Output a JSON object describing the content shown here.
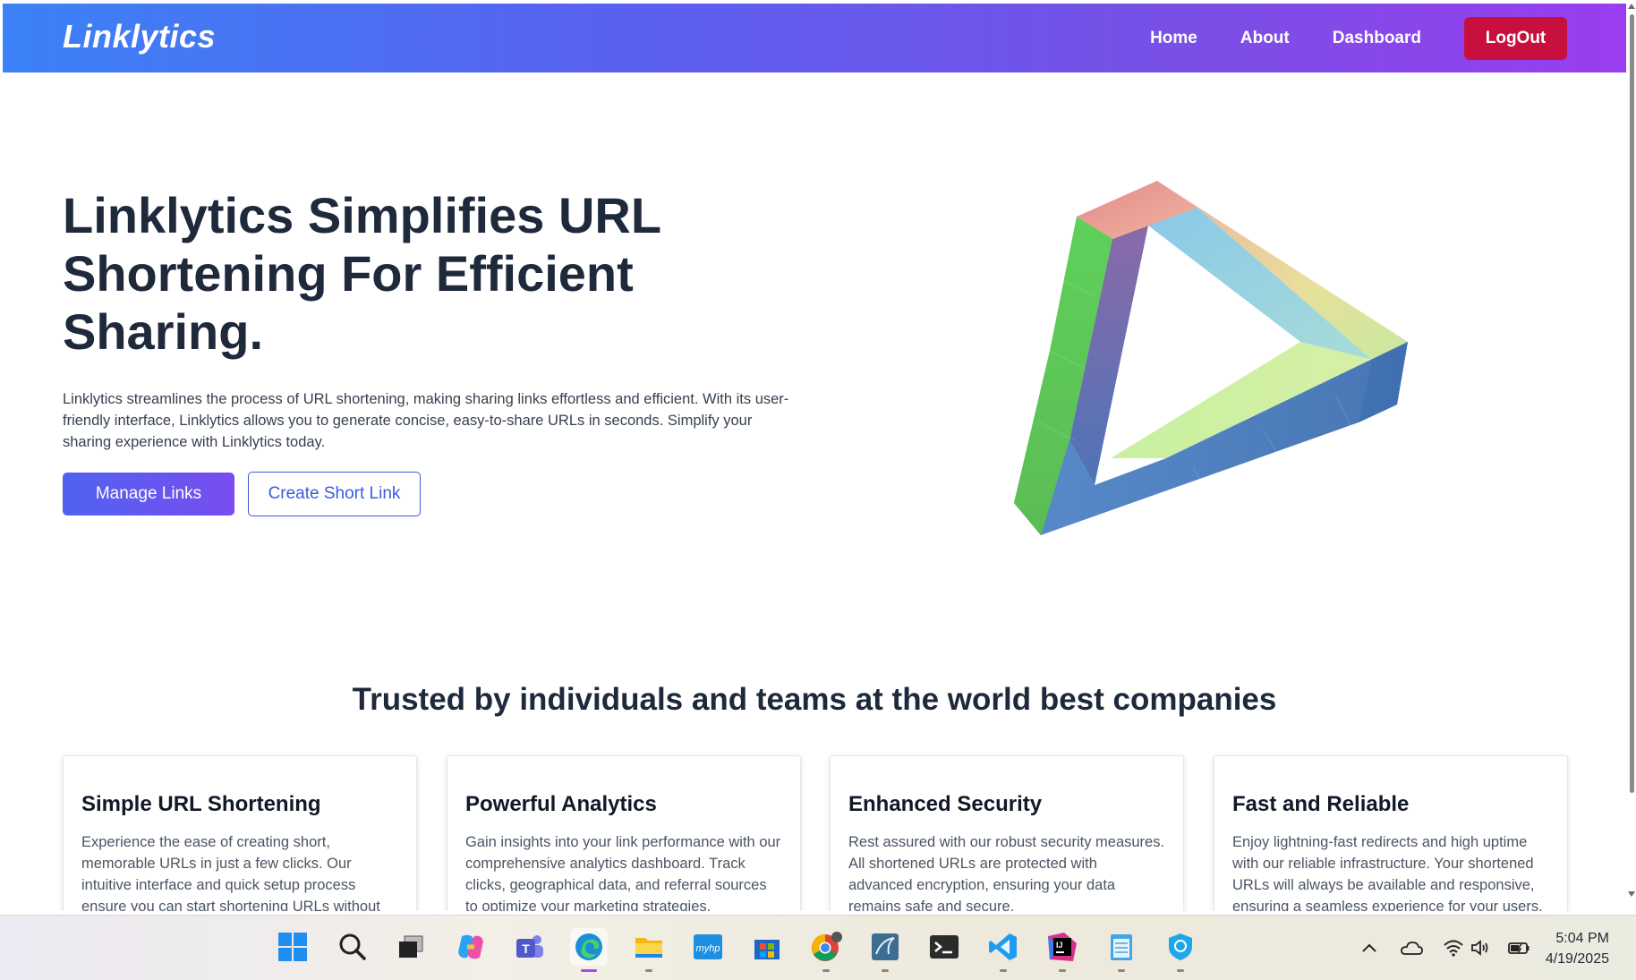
{
  "navbar": {
    "brand": "Linklytics",
    "links": [
      "Home",
      "About",
      "Dashboard"
    ],
    "logout_label": "LogOut"
  },
  "hero": {
    "title": "Linklytics Simplifies URL Shortening For Efficient Sharing.",
    "description": "Linklytics streamlines the process of URL shortening, making sharing links effortless and efficient. With its user-friendly interface, Linklytics allows you to generate concise, easy-to-share URLs in seconds. Simplify your sharing experience with Linklytics today.",
    "primary_button": "Manage Links",
    "secondary_button": "Create Short Link"
  },
  "trusted": {
    "heading": "Trusted by individuals and teams at the world best companies"
  },
  "features": [
    {
      "title": "Simple URL Shortening",
      "text": "Experience the ease of creating short, memorable URLs in just a few clicks. Our intuitive interface and quick setup process ensure you can start shortening URLs without"
    },
    {
      "title": "Powerful Analytics",
      "text": "Gain insights into your link performance with our comprehensive analytics dashboard. Track clicks, geographical data, and referral sources to optimize your marketing strategies."
    },
    {
      "title": "Enhanced Security",
      "text": "Rest assured with our robust security measures. All shortened URLs are protected with advanced encryption, ensuring your data remains safe and secure."
    },
    {
      "title": "Fast and Reliable",
      "text": "Enjoy lightning-fast redirects and high uptime with our reliable infrastructure. Your shortened URLs will always be available and responsive, ensuring a seamless experience for your users."
    }
  ],
  "colors": {
    "logout": "#c8103e",
    "accent": "#3b5bdb",
    "heading": "#1e293b"
  },
  "taskbar": {
    "apps": [
      "windows-start-icon",
      "search-icon",
      "task-view-icon",
      "copilot-icon",
      "teams-icon",
      "edge-icon",
      "file-explorer-icon",
      "myhp-icon",
      "microsoft-store-icon",
      "chrome-icon",
      "mysql-workbench-icon",
      "terminal-icon",
      "vscode-icon",
      "intellij-icon",
      "notepad-icon",
      "vpn-shield-icon"
    ],
    "myhp_label": "myhp",
    "intellij_label": "IJ",
    "time": "5:04 PM",
    "date": "4/19/2025"
  }
}
